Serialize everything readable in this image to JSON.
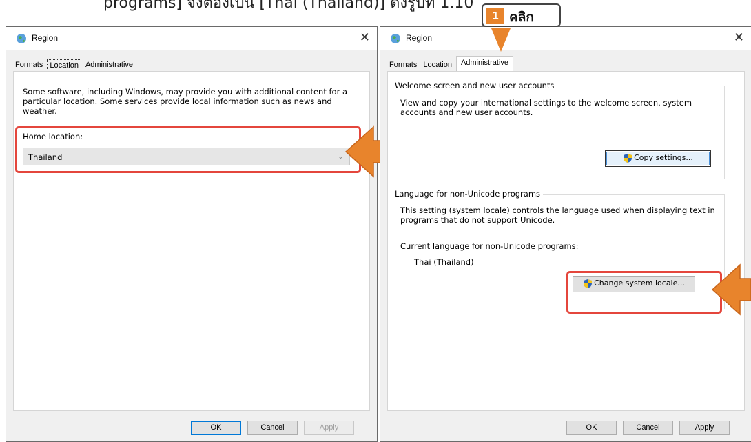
{
  "caption": "programs] จึงต้องเป็น [Thai (Thailand)] ดังรูปที่ 1.10",
  "callout": {
    "step": "1",
    "text": "คลิก"
  },
  "left_dialog": {
    "title": "Region",
    "close": "✕",
    "tabs": [
      "Formats",
      "Location",
      "Administrative"
    ],
    "active_tab": "Location",
    "description": "Some software, including Windows, may provide you with additional content for a particular location. Some services provide local information such as news and weather.",
    "home_location_label": "Home location:",
    "home_location_value": "Thailand",
    "buttons": {
      "ok": "OK",
      "cancel": "Cancel",
      "apply": "Apply"
    }
  },
  "right_dialog": {
    "title": "Region",
    "close": "✕",
    "tabs": [
      "Formats",
      "Location",
      "Administrative"
    ],
    "active_tab": "Administrative",
    "welcome_group": {
      "title": "Welcome screen and new user accounts",
      "description": "View and copy your international settings to the welcome screen, system accounts and new user accounts.",
      "button": "Copy settings..."
    },
    "unicode_group": {
      "title": "Language for non-Unicode programs",
      "description": "This setting (system locale) controls the language used when displaying text in programs that do not support Unicode.",
      "current_label": "Current language for non-Unicode programs:",
      "current_value": "Thai (Thailand)",
      "button": "Change system locale..."
    },
    "buttons": {
      "ok": "OK",
      "cancel": "Cancel",
      "apply": "Apply"
    }
  },
  "colors": {
    "highlight": "#e4463c",
    "arrow": "#e8842c",
    "callout_number": "#e8842c"
  }
}
